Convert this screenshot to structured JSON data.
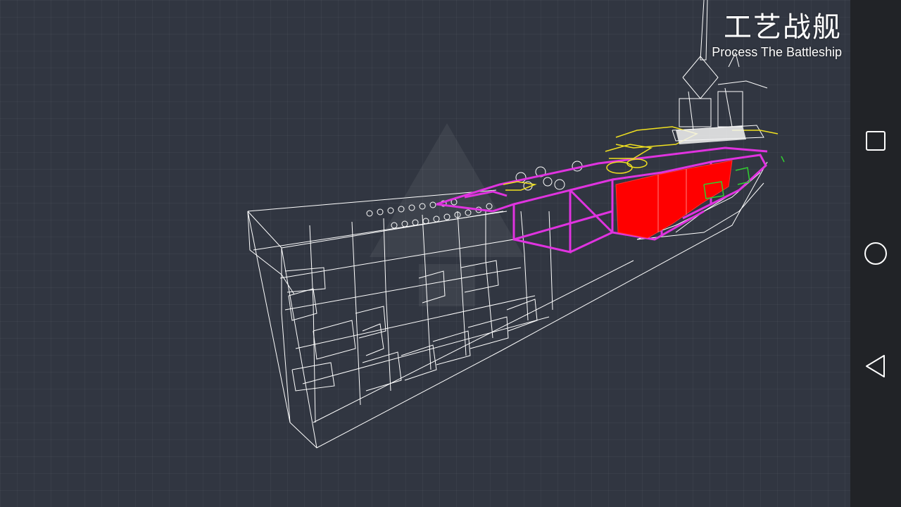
{
  "app": {
    "title_cn": "工艺战舰",
    "title_en": "Process The Battleship"
  },
  "viewport": {
    "view_mode": "wireframe",
    "colors": {
      "background": "#313641",
      "hull_lines": "#ffffff",
      "frame_lines": "#e033e0",
      "armor_fill": "#ff0000",
      "turret_lines": "#f0e020",
      "detail_lines": "#30d030"
    }
  },
  "navbar": {
    "buttons": [
      {
        "icon": "recent-apps-square-icon"
      },
      {
        "icon": "home-circle-icon"
      },
      {
        "icon": "back-triangle-icon"
      }
    ]
  }
}
